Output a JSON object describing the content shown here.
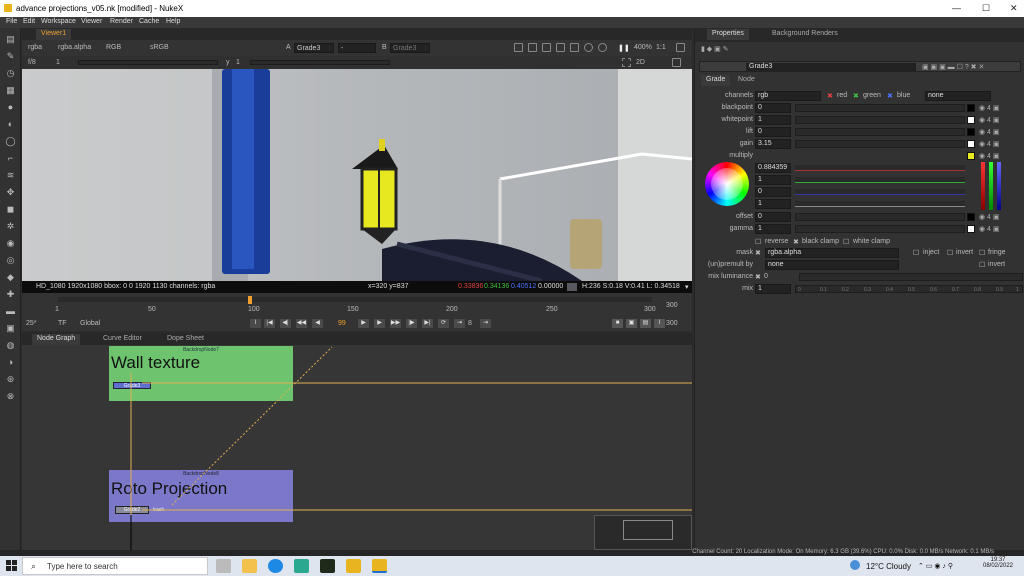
{
  "window": {
    "title": "advance projections_v05.nk [modified] - NukeX",
    "min": "—",
    "max": "☐",
    "close": "✕"
  },
  "menu": [
    "File",
    "Edit",
    "Workspace",
    "Viewer",
    "Render",
    "Cache",
    "Help"
  ],
  "viewer": {
    "tab": "Viewer1",
    "channels": "rgba",
    "alpha": "rgba.alpha",
    "rgb": "RGB",
    "colorspace": "sRGB",
    "input_a_label": "A",
    "input_a": "Grade3",
    "input_dash": "-",
    "input_b_label": "B",
    "input_b": "Grade3",
    "zoom": "400%",
    "ratio": "1:1",
    "mode": "2D",
    "fstop": "f/8",
    "fstop_val": "1",
    "y_label": "y",
    "y_val": "1"
  },
  "info": {
    "format": "HD_1080 1920x1080  bbox: 0 0 1920 1130 channels: rgba",
    "coords": "x=320 y=837",
    "r": "0.33836",
    "g": "0.34136",
    "b": "0.40512",
    "a": "0.00000",
    "hsv": "H:236 S:0.18 V:0.41  L: 0.34518"
  },
  "timeline": {
    "ticks": [
      "1",
      "50",
      "100",
      "150",
      "200",
      "250",
      "300"
    ],
    "end": "300",
    "fps": "25*",
    "tf": "TF",
    "global": "Global",
    "frame": "99",
    "step": "8",
    "end_frame": "300"
  },
  "nodegraph": {
    "tabs": [
      "Node Graph",
      "Curve Editor",
      "Dope Sheet"
    ],
    "backdrops": [
      {
        "label": "BackdropNode7",
        "title": "Wall texture",
        "color": "#6ec46e"
      },
      {
        "label": "BackdropNode8",
        "title": "Roto Projection",
        "color": "#7b78c9"
      }
    ],
    "node_in_wall": "Grade3",
    "node_in_roto": "Grade2",
    "node_trash": "trash"
  },
  "properties": {
    "tabs": [
      "Properties",
      "Background Renders"
    ],
    "node_name": "Grade3",
    "subtabs": [
      "Grade",
      "Node"
    ],
    "channels_label": "channels",
    "channels_val": "rgb",
    "ch_red": "red",
    "ch_green": "green",
    "ch_blue": "blue",
    "ch_none": "none",
    "rows": [
      {
        "label": "blackpoint",
        "value": "0"
      },
      {
        "label": "whitepoint",
        "value": "1"
      },
      {
        "label": "lift",
        "value": "0"
      },
      {
        "label": "gain",
        "value": "3.15"
      }
    ],
    "multiply_label": "multiply",
    "multiply_vals": [
      "0.884359",
      "1",
      "0",
      "1"
    ],
    "offset_label": "offset",
    "offset_val": "0",
    "gamma_label": "gamma",
    "gamma_val": "1",
    "reverse": "reverse",
    "black_clamp": "black clamp",
    "white_clamp": "white clamp",
    "mask_label": "mask",
    "mask_val": "rgba.alpha",
    "inject": "inject",
    "invert": "invert",
    "fringe": "fringe",
    "unpremult_label": "(un)premult by",
    "unpremult_val": "none",
    "invert2": "invert",
    "mixlum_label": "mix luminance",
    "mixlum_val": "0",
    "mix_label": "mix",
    "mix_val": "1",
    "slider_ticks": [
      "0",
      "0.1",
      "0.2",
      "0.3",
      "0.4",
      "0.5",
      "0.6",
      "0.7",
      "0.8",
      "0.9",
      "1"
    ]
  },
  "status": "Channel Count: 20  Localization Mode: On  Memory: 6.3 GB (39.6%)  CPU: 0.0%  Disk: 0.0 MB/s  Network: 0.1 MB/s",
  "taskbar": {
    "search_placeholder": "Type here to search",
    "weather": "12°C  Cloudy",
    "time": "19:37",
    "date": "08/02/2022"
  }
}
